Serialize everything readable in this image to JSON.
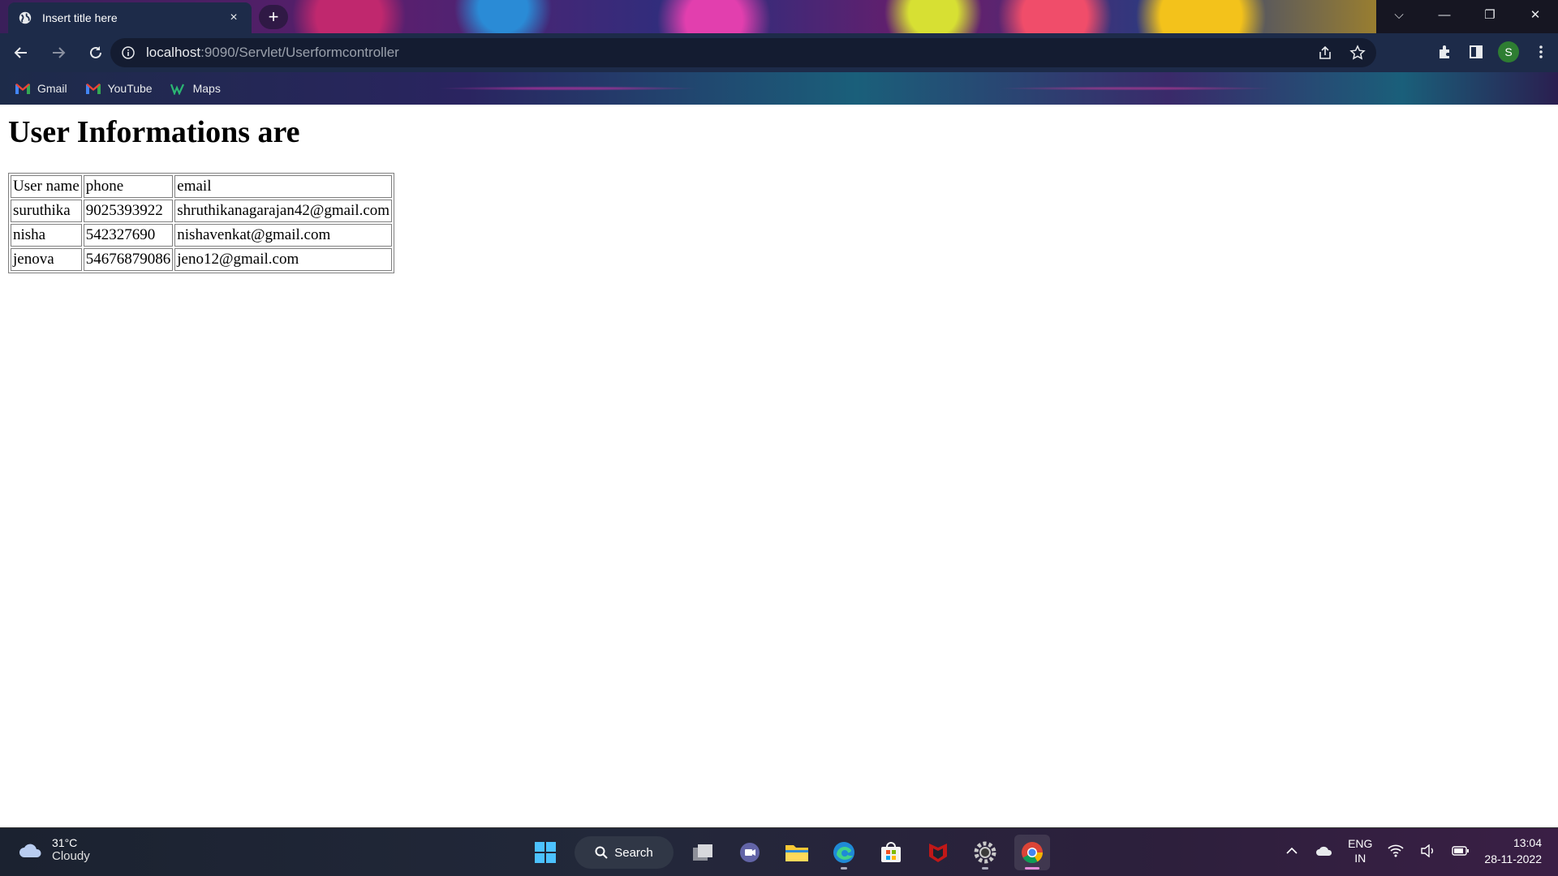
{
  "browser": {
    "tab_title": "Insert title here",
    "tab_close": "×",
    "new_tab": "+",
    "url_host": "localhost",
    "url_path": ":9090/Servlet/Userformcontroller",
    "bookmarks": [
      {
        "label": "Gmail",
        "icon": "gmail-icon"
      },
      {
        "label": "YouTube",
        "icon": "gmail-icon"
      },
      {
        "label": "Maps",
        "icon": "maps-icon"
      }
    ],
    "avatar_initial": "S"
  },
  "page": {
    "heading": "User Informations are",
    "table": {
      "headers": [
        "User name",
        "phone",
        "email"
      ],
      "rows": [
        [
          "suruthika",
          "9025393922",
          "shruthikanagarajan42@gmail.com"
        ],
        [
          "nisha",
          "542327690",
          "nishavenkat@gmail.com"
        ],
        [
          "jenova",
          "54676879086",
          "jeno12@gmail.com"
        ]
      ]
    }
  },
  "taskbar": {
    "weather_temp": "31°C",
    "weather_desc": "Cloudy",
    "search_label": "Search",
    "lang_top": "ENG",
    "lang_bottom": "IN",
    "time": "13:04",
    "date": "28-11-2022"
  }
}
